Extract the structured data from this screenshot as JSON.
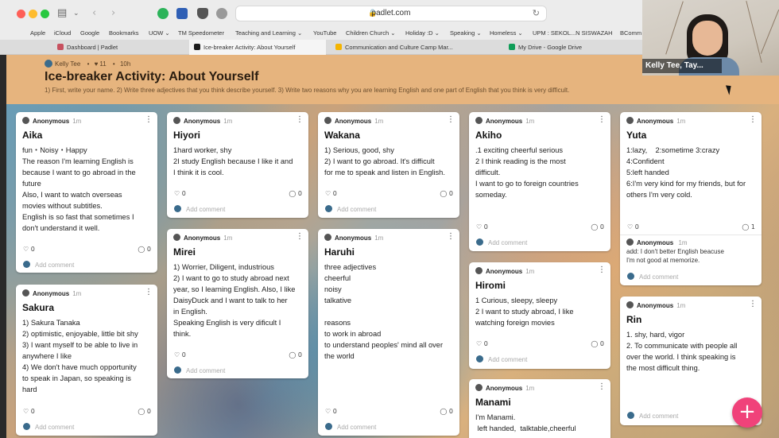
{
  "browser": {
    "url": "padlet.com",
    "bookmarks": [
      "Apple",
      "iCloud",
      "Google",
      "Bookmarks",
      "UOW ⌄",
      "TM Speedometer",
      "Teaching and Learning ⌄",
      "YouTube",
      "Children Church ⌄",
      "Holiday :D ⌄",
      "Speaking ⌄",
      "Homeless ⌄",
      "UPM : SEKOL...N SISWAZAH",
      "BComm"
    ],
    "tabs": [
      {
        "label": "Dashboard | Padlet"
      },
      {
        "label": "Ice-breaker Activity: About Yourself"
      },
      {
        "label": "Communication and Culture Camp Mar..."
      },
      {
        "label": "My Drive - Google Drive"
      }
    ]
  },
  "padlet": {
    "author": "Kelly Tee",
    "likes": "11",
    "age": "10h",
    "title": "Ice-breaker Activity: About Yourself",
    "description": "1) First, write your name. 2) Write three adjectives that you think describe yourself. 3) Write two reasons why you are learning English and one part of English that you think is very difficult."
  },
  "card_meta": {
    "author": "Anonymous",
    "time": "1m",
    "add_comment": "Add comment"
  },
  "cards": [
    {
      "title": "Aika",
      "lines": [
        "fun・Noisy・Happy",
        "The reason I'm learning English is",
        "because I want to go abroad in the",
        "future",
        "Also, I want to watch overseas",
        "movies without subtitles.",
        "English is so fast that sometimes I",
        "don't understand it well."
      ],
      "likes": "0",
      "comments": "0"
    },
    {
      "title": "Sakura",
      "lines": [
        "1) Sakura Tanaka",
        "2) optimistic, enjoyable, little bit shy",
        "3) I want myself to be able to live in",
        "anywhere I like",
        "4) We don't have much opportunity",
        "to speak in Japan, so speaking is",
        "hard"
      ],
      "likes": "0",
      "comments": "0"
    },
    {
      "title": "Hiyori",
      "lines": [
        "1hard worker, shy",
        "2I study English because I like it and",
        "I think it is cool."
      ],
      "likes": "0",
      "comments": "0"
    },
    {
      "title": "Mirei",
      "lines": [
        "1) Worrier, Diligent, industrious",
        "2) I want to go to study abroad next",
        "year, so I learning English. Also, I like",
        "DaisyDuck and I want to talk to her",
        "in English.",
        "Speaking English is very dificult I",
        "think."
      ],
      "likes": "0",
      "comments": "0"
    },
    {
      "title": "Wakana",
      "lines": [
        "1) Serious, good, shy",
        "2) I want to go abroad. It's difficult",
        "for me to speak and listen in English."
      ],
      "likes": "0",
      "comments": "0"
    },
    {
      "title": "Haruhi",
      "lines": [
        "three adjectives",
        "cheerful",
        "noisy",
        "talkative",
        "",
        "reasons",
        "to work in abroad",
        "to understand peoples' mind all over",
        "the world"
      ],
      "likes": "0",
      "comments": "0"
    },
    {
      "title": "Akiho",
      "lines": [
        ".1 exciting cheerful  serious",
        "2 I think  reading  is  the most",
        "difficult.",
        "I want to go to foreign countries",
        "someday."
      ],
      "likes": "0",
      "comments": "0"
    },
    {
      "title": "Hiromi",
      "lines": [
        "1 Curious, sleepy, sleepy",
        "2 I want to study abroad, I like",
        "watching foreign movies"
      ],
      "likes": "0",
      "comments": "0"
    },
    {
      "title": "Manami",
      "lines": [
        "I'm Manami.",
        " left handed,  talktable,cheerful"
      ]
    },
    {
      "title": "Yuta",
      "lines": [
        "1:lazy,    2:sometime 3:crazy",
        "4:Confident",
        "5:left handed",
        "6:I'm very kind for my friends, but for",
        "others I'm very cold."
      ],
      "likes": "0",
      "comments": "1",
      "reply": {
        "author": "Anonymous",
        "time": "1m",
        "lines": [
          "add: I don't better English beacuse",
          "I'm not good at memorize."
        ]
      }
    },
    {
      "title": "Rin",
      "lines": [
        "1. shy, hard, vigor",
        "2. To communicate with people all",
        "over the world. I think speaking is",
        "the most difficult thing."
      ]
    }
  ],
  "video": {
    "participant": "Kelly Tee, Tay..."
  },
  "watermark": "zoom",
  "fab": "+"
}
